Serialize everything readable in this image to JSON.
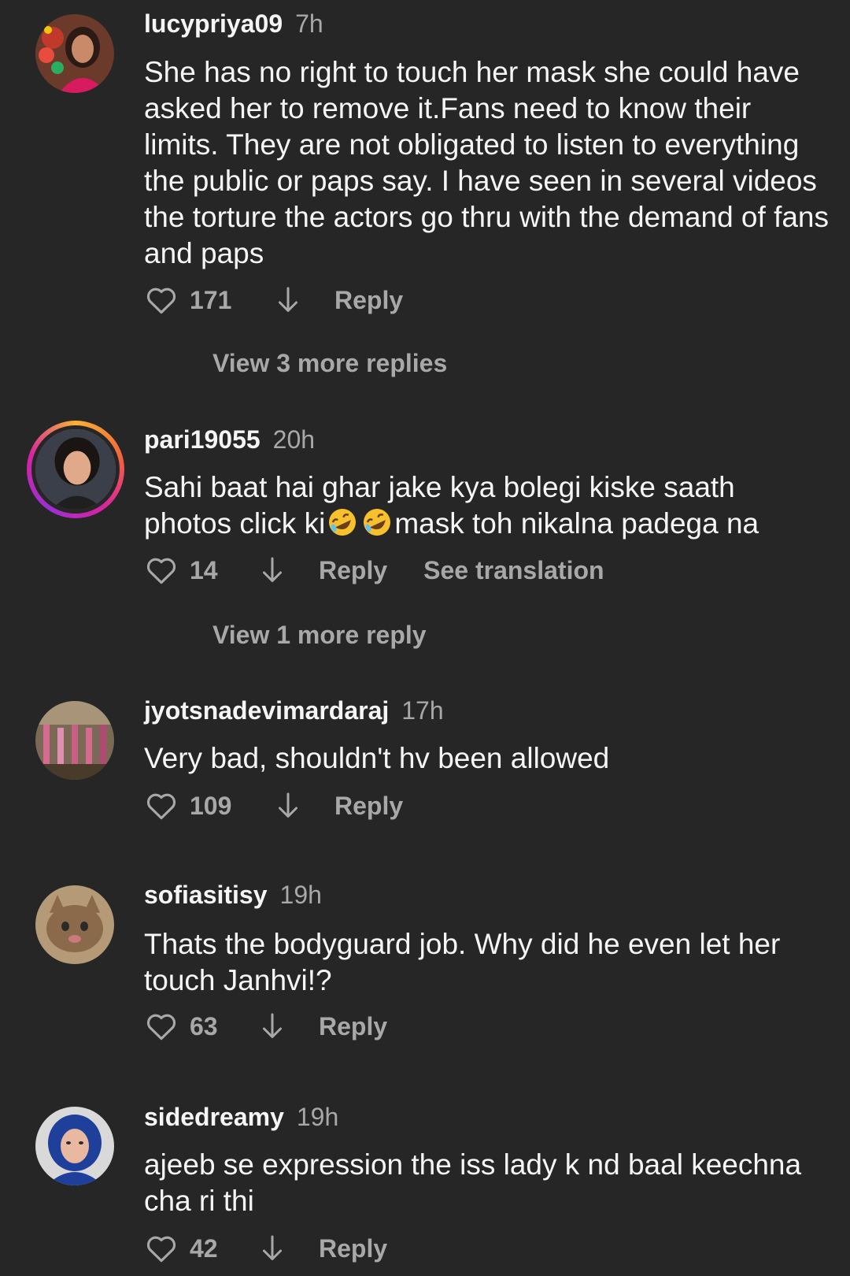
{
  "comments": [
    {
      "username": "lucypriya09",
      "time": "7h",
      "text": "She has no right to touch her mask she could have asked her to remove it.Fans need to know their limits. They are not obligated to listen to everything the public or paps say. I have seen in several videos the torture the actors go thru with the demand of fans and paps",
      "likes": "171",
      "reply_label": "Reply",
      "view_more": "View 3 more replies"
    },
    {
      "username": "pari19055",
      "time": "20h",
      "text_before_emoji": "Sahi baat hai ghar jake kya bolegi kiske saath photos click ki",
      "emoji": "rolling-on-the-floor-laughing",
      "text_after_emoji": "mask toh nikalna padega na",
      "likes": "14",
      "reply_label": "Reply",
      "translation_label": "See translation",
      "view_more": "View 1 more reply"
    },
    {
      "username": "jyotsnadevimardaraj",
      "time": "17h",
      "text": "Very bad, shouldn't hv been allowed",
      "likes": "109",
      "reply_label": "Reply"
    },
    {
      "username": "sofiasitisy",
      "time": "19h",
      "text": "Thats the bodyguard job. Why did he even let her touch Janhvi!?",
      "likes": "63",
      "reply_label": "Reply"
    },
    {
      "username": "sidedreamy",
      "time": "19h",
      "text": "ajeeb se expression the iss lady k nd baal keechna cha ri thi",
      "likes": "42",
      "reply_label": "Reply"
    }
  ],
  "colors": {
    "background": "#262626",
    "primary_text": "#f5f5f5",
    "secondary_text": "#a8a8a8"
  },
  "icons": [
    "heart-icon",
    "down-arrow-icon",
    "laughing-emoji-icon"
  ]
}
